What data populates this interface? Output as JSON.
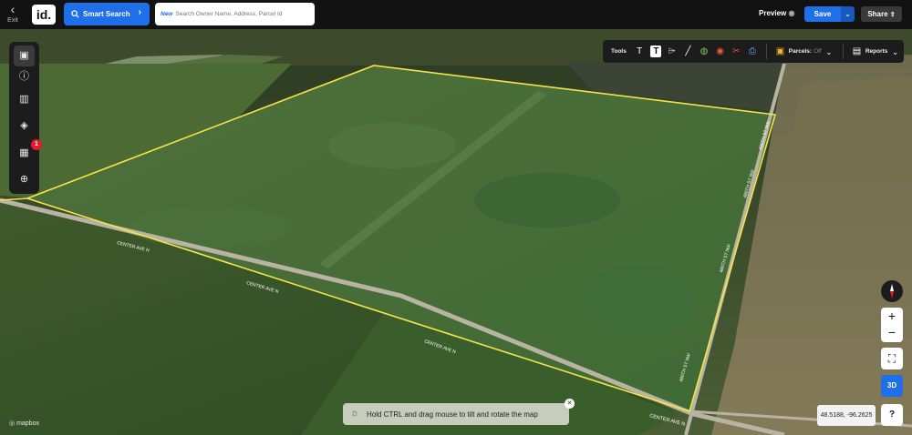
{
  "topbar": {
    "exit_label": "Exit",
    "logo": "id.",
    "smart_search_label": "Smart Search",
    "search_new_tag": "New",
    "search_placeholder": "Search Owner Name, Address, Parcel Id",
    "preview_label": "Preview",
    "save_label": "Save",
    "share_label": "Share"
  },
  "toolbar": {
    "tools_label": "Tools",
    "parcels_label": "Parcels:",
    "parcels_state": "Off",
    "reports_label": "Reports"
  },
  "sidebar": {
    "notification_count": "1"
  },
  "map": {
    "road_labels": [
      "CENTER AVE N",
      "CENTER AVE N",
      "CENTER AVE N",
      "CENTER AVE N",
      "480TH ST NW",
      "480TH ST NW",
      "480TH ST NW",
      "480TH ST NW"
    ],
    "parcel_outline_color": "#f4e44a",
    "hint_text": "Hold CTRL and drag mouse to tilt and rotate the map",
    "coordinates": "48.5188, -96.2625",
    "attribution": "mapbox",
    "mode_3d_label": "3D"
  },
  "controls": {
    "zoom_in": "+",
    "zoom_out": "−",
    "help": "?"
  },
  "colors": {
    "accent": "#1f6fe8",
    "badge": "#e21b2a"
  }
}
